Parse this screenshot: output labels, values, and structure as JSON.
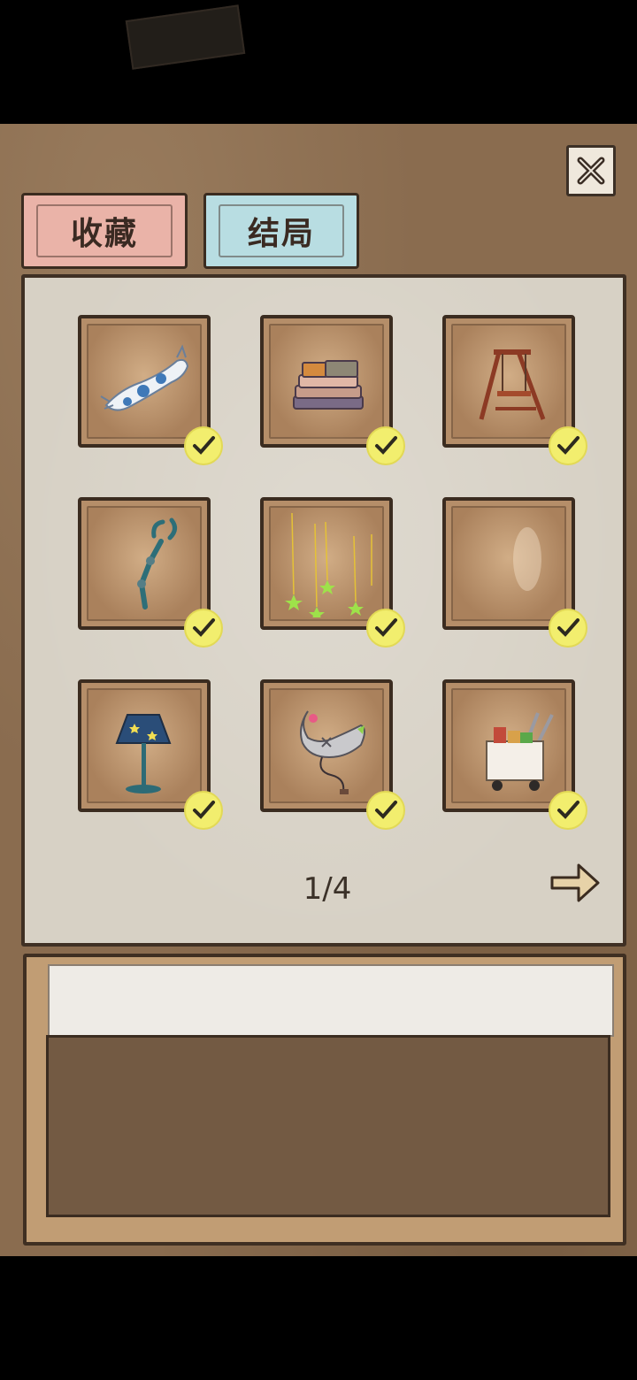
{
  "tabs": [
    {
      "label": "收藏",
      "active": true,
      "color": "#eab3a8"
    },
    {
      "label": "结局",
      "active": false,
      "color": "#b8dde2"
    }
  ],
  "items": [
    {
      "name": "cat-pillow",
      "collected": true
    },
    {
      "name": "stacked-clothes",
      "collected": true
    },
    {
      "name": "wooden-swing",
      "collected": true
    },
    {
      "name": "grabber-claw",
      "collected": true
    },
    {
      "name": "star-strings",
      "collected": true
    },
    {
      "name": "empty-item",
      "collected": true
    },
    {
      "name": "star-lamp",
      "collected": true
    },
    {
      "name": "game-controller",
      "collected": true
    },
    {
      "name": "shopping-cart",
      "collected": true
    }
  ],
  "pagination": {
    "indicator": "1/4"
  },
  "icons": {
    "close": "close-x-icon",
    "next": "arrow-right-icon",
    "check": "checkmark-icon"
  },
  "colors": {
    "background": "#8a6c4f",
    "panel": "#d7d1c5",
    "slot": "#b58e69",
    "check": "#f2ee6e"
  }
}
